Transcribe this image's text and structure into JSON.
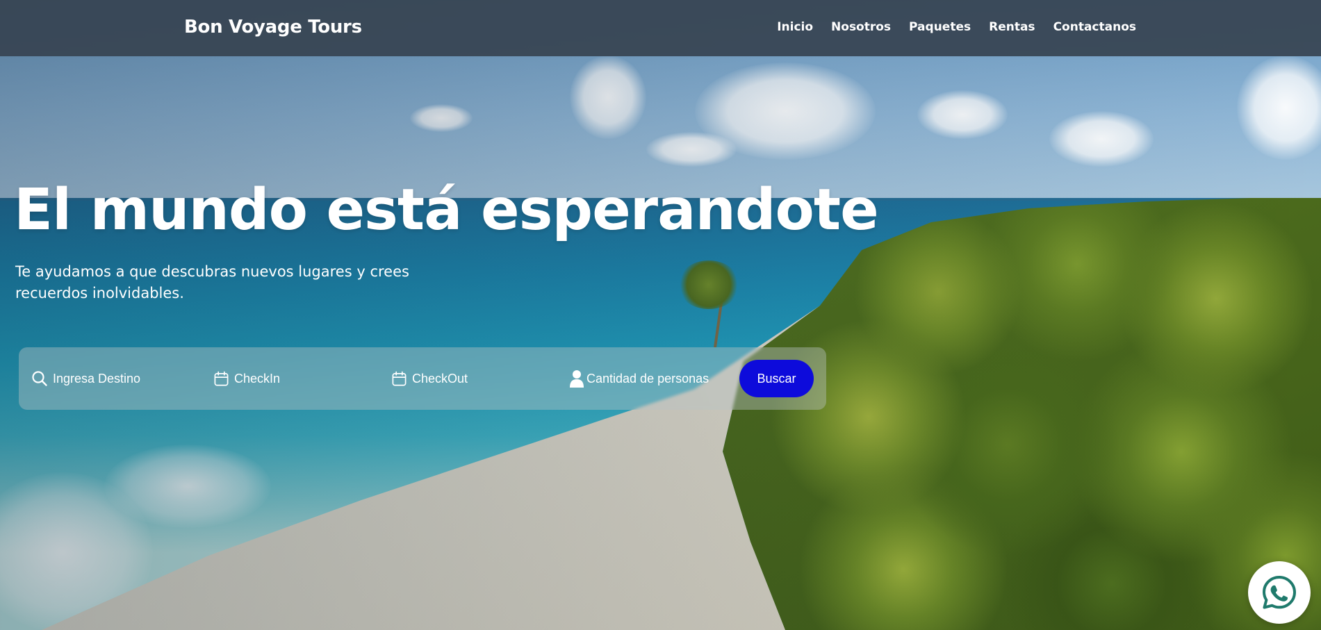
{
  "navbar": {
    "brand": "Bon Voyage Tours",
    "links": [
      {
        "label": "Inicio"
      },
      {
        "label": "Nosotros"
      },
      {
        "label": "Paquetes"
      },
      {
        "label": "Rentas"
      },
      {
        "label": "Contactanos"
      }
    ]
  },
  "hero": {
    "title": "El mundo está esperandote",
    "subtitle": "Te ayudamos a que descubras nuevos lugares y crees recuerdos inolvidables."
  },
  "search": {
    "destination_placeholder": "Ingresa Destino",
    "checkin_placeholder": "CheckIn",
    "checkout_placeholder": "CheckOut",
    "guests_placeholder": "Cantidad de personas",
    "button_label": "Buscar",
    "button_color": "#0d0bdb"
  },
  "icons": {
    "destination": "search-icon",
    "checkin": "calendar-icon",
    "checkout": "calendar-icon",
    "guests": "person-icon",
    "floating": "whatsapp-icon"
  },
  "colors": {
    "navbar_bg": "#374452",
    "text": "#ffffff",
    "whatsapp_green": "#1f7a6c"
  }
}
